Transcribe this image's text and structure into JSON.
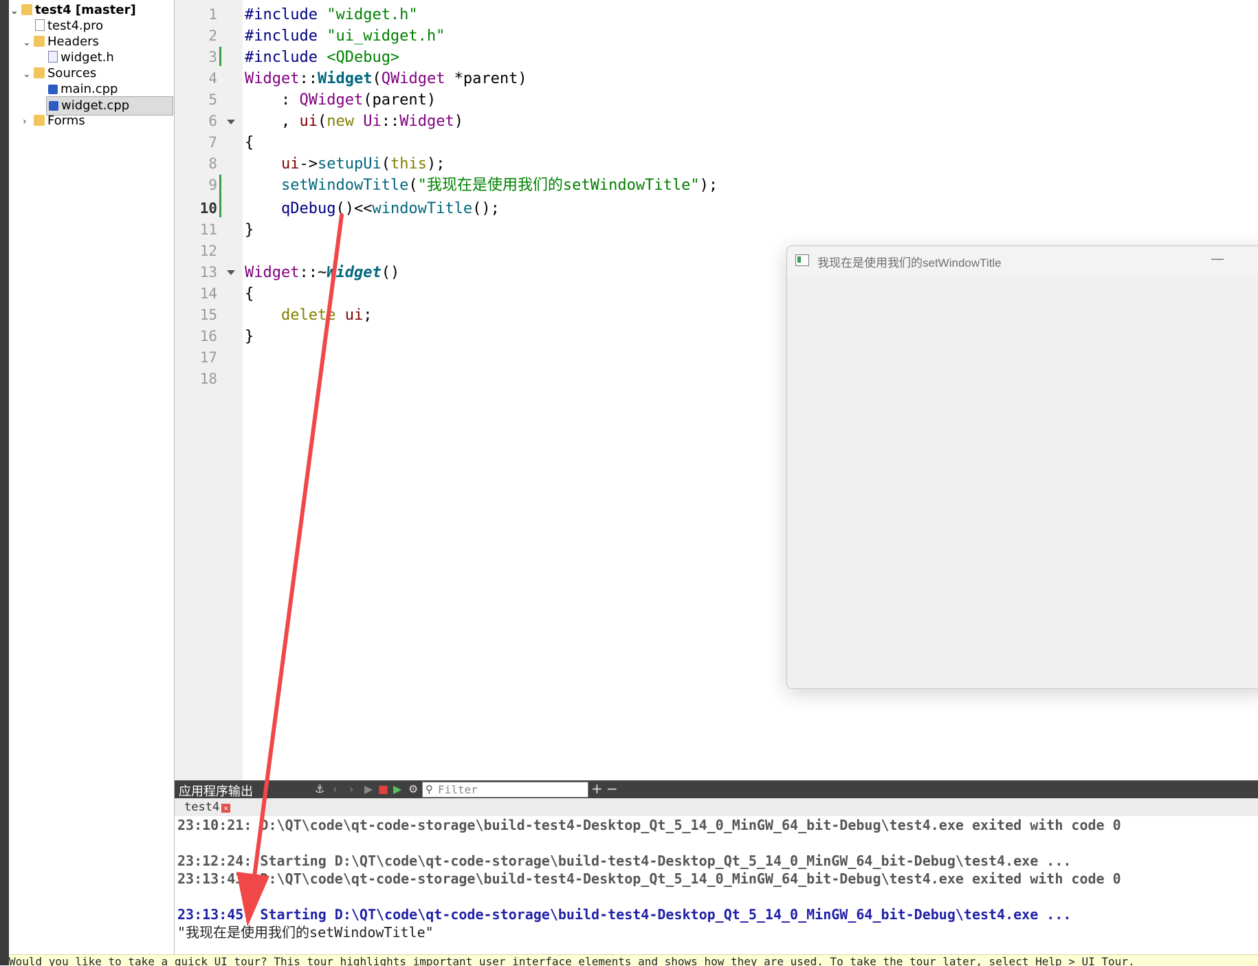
{
  "project_tree": {
    "items": [
      {
        "label": "test4 [master]",
        "icon": "project-folder-icon"
      },
      {
        "label": "test4.pro",
        "icon": "pro-file-icon"
      },
      {
        "label": "Headers",
        "icon": "headers-folder-icon"
      },
      {
        "label": "widget.h",
        "icon": "header-file-icon"
      },
      {
        "label": "Sources",
        "icon": "sources-folder-icon"
      },
      {
        "label": "main.cpp",
        "icon": "cpp-file-icon"
      },
      {
        "label": "widget.cpp",
        "icon": "cpp-file-icon"
      },
      {
        "label": "Forms",
        "icon": "forms-folder-icon"
      }
    ]
  },
  "editor": {
    "line_numbers": [
      "1",
      "2",
      "3",
      "4",
      "5",
      "6",
      "7",
      "8",
      "9",
      "10",
      "11",
      "12",
      "13",
      "14",
      "15",
      "16",
      "17",
      "18"
    ],
    "current_line": "10",
    "code": {
      "l1_a": "#include ",
      "l1_b": "\"widget.h\"",
      "l2_a": "#include ",
      "l2_b": "\"ui_widget.h\"",
      "l3_a": "#include ",
      "l3_b": "<QDebug>",
      "l4_a": "Widget",
      "l4_b": "::",
      "l4_c": "Widget",
      "l4_d": "(",
      "l4_e": "QWidget",
      "l4_f": " *parent)",
      "l5_a": "    : ",
      "l5_b": "QWidget",
      "l5_c": "(parent)",
      "l6_a": "    , ",
      "l6_b": "ui",
      "l6_c": "(",
      "l6_d": "new ",
      "l6_e": "Ui",
      "l6_f": "::",
      "l6_g": "Widget",
      "l6_h": ")",
      "l7": "{",
      "l8_a": "    ",
      "l8_b": "ui",
      "l8_c": "->",
      "l8_d": "setupUi",
      "l8_e": "(",
      "l8_f": "this",
      "l8_g": ");",
      "l9_a": "    ",
      "l9_b": "setWindowTitle",
      "l9_c": "(",
      "l9_d": "\"我现在是使用我们的setWindowTitle\"",
      "l9_e": ");",
      "l10_a": "    ",
      "l10_b": "qDebug",
      "l10_c": "()<<",
      "l10_d": "windowTitle",
      "l10_e": "();",
      "l11": "}",
      "l13_a": "Widget",
      "l13_b": "::~",
      "l13_c": "Widget",
      "l13_d": "()",
      "l14": "{",
      "l15_a": "    ",
      "l15_b": "delete ",
      "l15_c": "ui",
      "l15_d": ";",
      "l16": "}"
    }
  },
  "app_window": {
    "title": "我现在是使用我们的setWindowTitle",
    "minimize_glyph": "—"
  },
  "output_pane": {
    "title": "应用程序输出",
    "filter_placeholder": "Filter",
    "add_glyph": "+",
    "remove_glyph": "−",
    "tab_label": "test4",
    "lines": [
      {
        "text": "23:10:21: D:\\QT\\code\\qt-code-storage\\build-test4-Desktop_Qt_5_14_0_MinGW_64_bit-Debug\\test4.exe exited with code 0"
      },
      {
        "text": "23:12:24: Starting D:\\QT\\code\\qt-code-storage\\build-test4-Desktop_Qt_5_14_0_MinGW_64_bit-Debug\\test4.exe ..."
      },
      {
        "text": "23:13:43: D:\\QT\\code\\qt-code-storage\\build-test4-Desktop_Qt_5_14_0_MinGW_64_bit-Debug\\test4.exe exited with code 0"
      },
      {
        "text": "23:13:45: Starting D:\\QT\\code\\qt-code-storage\\build-test4-Desktop_Qt_5_14_0_MinGW_64_bit-Debug\\test4.exe ..."
      },
      {
        "text": "\"我现在是使用我们的setWindowTitle\""
      }
    ]
  },
  "status_bar": {
    "text": "Would you like to take a quick UI tour? This tour highlights important user interface elements and shows how they are used. To take the tour later, select Help > UI Tour."
  },
  "colors": {
    "annotation_arrow": "#f04848",
    "preprocessor": "#000080",
    "string": "#008000",
    "class": "#800080",
    "function": "#00677c",
    "keyword": "#808000",
    "member": "#800000"
  }
}
